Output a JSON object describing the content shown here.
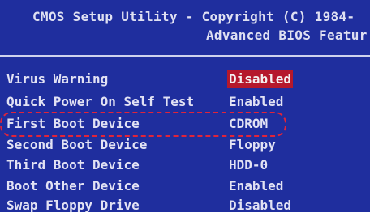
{
  "header": {
    "line1": "CMOS Setup Utility - Copyright (C) 1984-",
    "line2": "Advanced BIOS Featur"
  },
  "settings": [
    {
      "label": "Virus Warning",
      "value": "Disabled",
      "selected": true
    },
    {
      "label": "Quick Power On Self Test",
      "value": "Enabled"
    },
    {
      "label": "First Boot Device",
      "value": "CDROM",
      "circled": true
    },
    {
      "label": "Second Boot Device",
      "value": "Floppy"
    },
    {
      "label": "Third Boot Device",
      "value": "HDD-0"
    },
    {
      "label": "Boot Other Device",
      "value": "Enabled"
    },
    {
      "label": "Swap Floppy Drive",
      "value": "Disabled"
    }
  ],
  "colors": {
    "background": "#1f2e9e",
    "text": "#e2e2f4",
    "selection": "#b5182c",
    "callout": "#e0243a"
  }
}
